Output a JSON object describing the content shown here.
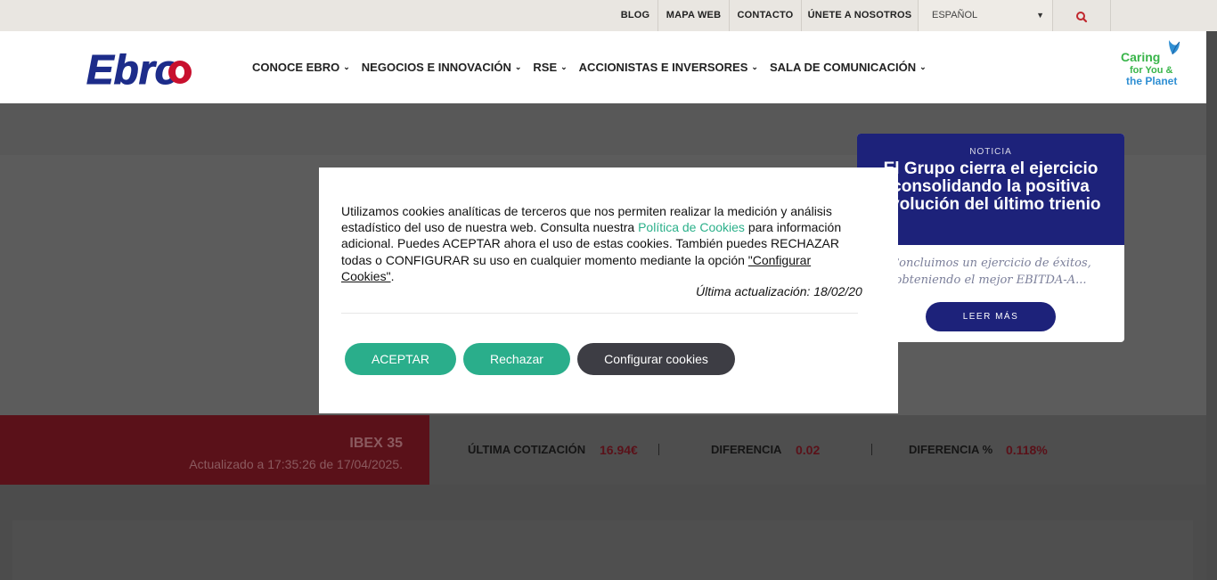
{
  "topbar": {
    "links": [
      "BLOG",
      "MAPA WEB",
      "CONTACTO",
      "ÚNETE A NOSOTROS"
    ],
    "language": "ESPAÑOL"
  },
  "header": {
    "logo_text": "Ebro",
    "nav": [
      "CONOCE EBRO",
      "NEGOCIOS E INNOVACIÓN",
      "RSE",
      "ACCIONISTAS E INVERSORES",
      "SALA DE COMUNICACIÓN"
    ],
    "badge_lines": [
      "Caring",
      "for You &",
      "the Planet"
    ]
  },
  "news": {
    "kicker": "NOTICIA",
    "title": "El Grupo cierra el ejercicio consolidando la positiva evolución del último trienio",
    "excerpt": "Concluimos un ejercicio de éxitos, obteniendo el mejor EBITDA-A...",
    "button": "LEER MÁS"
  },
  "cookie": {
    "text_part1": "Utilizamos cookies analíticas de terceros que nos permiten realizar la medición y análisis estadístico del uso de nuestra web. Consulta nuestra ",
    "policy_link": "Política de Cookies",
    "text_part2": " para información adicional. Puedes ACEPTAR ahora el uso de estas cookies. También puedes RECHAZAR todas o CONFIGURAR su uso en cualquier momento mediante la opción ",
    "config_link": "\"Configurar Cookies\"",
    "text_part3": ".",
    "updated": "Última actualización: 18/02/20",
    "accept": "ACEPTAR",
    "reject": "Rechazar",
    "configure": "Configurar cookies"
  },
  "stock": {
    "index": "IBEX 35",
    "updated": "Actualizado a 17:35:26 de 17/04/2025.",
    "last_label": "ÚLTIMA COTIZACIÓN",
    "last_value": "16.94€",
    "diff_label": "DIFERENCIA",
    "diff_value": "0.02",
    "diffpct_label": "DIFERENCIA %",
    "diffpct_value": "0.118%"
  },
  "colors": {
    "brand_blue": "#1d227a",
    "accept_green": "#2aae8b",
    "stock_red": "#5a1119"
  }
}
